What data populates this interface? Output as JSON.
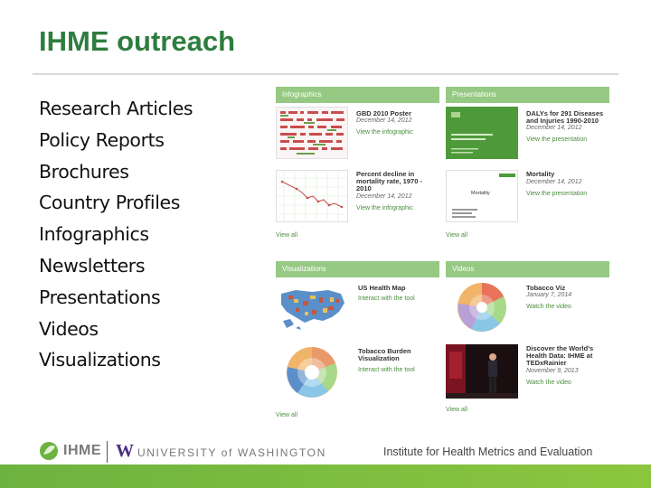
{
  "title": "IHME outreach",
  "bullets": [
    "Research Articles",
    "Policy Reports",
    "Brochures",
    "Country Profiles",
    "Infographics",
    "Newsletters",
    "Presentations",
    "Videos",
    "Visualizations"
  ],
  "colors": {
    "title": "#2e7d3f",
    "panel_header": "#96c983",
    "link": "#4a8e3c",
    "footer_bar": "#6db33f"
  },
  "panels": {
    "infographics": {
      "header": "Infographics",
      "view_all": "View all",
      "items": [
        {
          "title_lines": [
            "GBD 2010 Poster"
          ],
          "date": "December 14, 2012",
          "link": "View the infographic"
        },
        {
          "title_lines": [
            "Percent decline in",
            "mortality rate, 1970 -",
            "2010"
          ],
          "date": "December 14, 2012",
          "link": "View the infographic"
        }
      ]
    },
    "presentations": {
      "header": "Presentations",
      "view_all": "View all",
      "items": [
        {
          "title_lines": [
            "DALYs for 291 Diseases",
            "and Injuries 1990-2010"
          ],
          "date": "December 14, 2012",
          "link": "View the presentation"
        },
        {
          "title_lines": [
            "Mortality"
          ],
          "date": "December 14, 2012",
          "link": "View the presentation",
          "thumb_label": "Mortality"
        }
      ]
    },
    "visualizations": {
      "header": "Visualizations",
      "view_all": "View all",
      "items": [
        {
          "title_lines": [
            "US Health Map"
          ],
          "link": "Interact with the tool"
        },
        {
          "title_lines": [
            "Tobacco Burden",
            "Visualization"
          ],
          "link": "Interact with the tool"
        }
      ]
    },
    "videos": {
      "header": "Videos",
      "view_all": "View all",
      "items": [
        {
          "title_lines": [
            "Tobacco Viz"
          ],
          "date": "January 7, 2014",
          "link": "Watch the video"
        },
        {
          "title_lines": [
            "Discover the World's",
            "Health Data: IHME at",
            "TEDxRainier"
          ],
          "date": "November 9, 2013",
          "link": "Watch the video"
        }
      ]
    }
  },
  "footer": {
    "ihme_logo": "IHME",
    "uw_logo_w": "W",
    "uw_text": "UNIVERSITY of WASHINGTON",
    "institute": "Institute for Health Metrics and Evaluation"
  }
}
